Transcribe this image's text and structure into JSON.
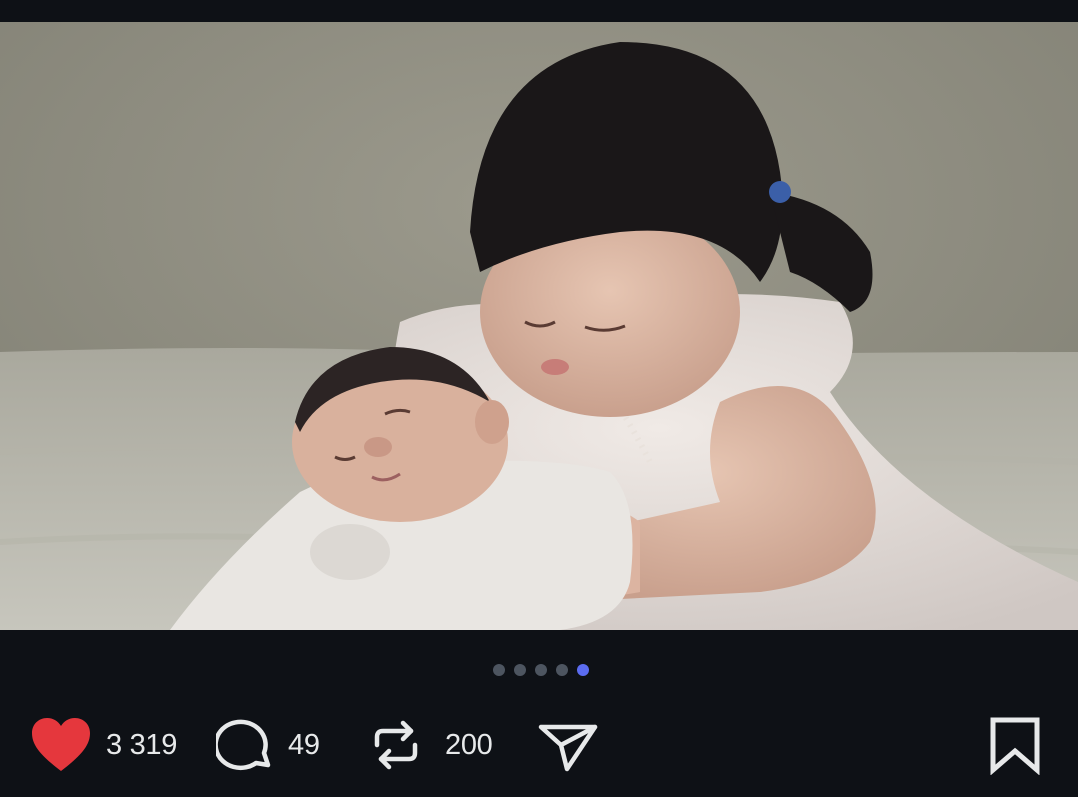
{
  "post": {
    "image": {
      "description_icon": "photo-of-child-holding-newborn"
    },
    "carousel": {
      "total": 5,
      "active_index": 4
    },
    "actions": {
      "like": {
        "icon": "heart-icon",
        "count": "3 319",
        "color": "#e5373d"
      },
      "reply": {
        "icon": "speech-bubble-icon",
        "count": "49"
      },
      "repost": {
        "icon": "repost-arrows-icon",
        "count": "200"
      },
      "share": {
        "icon": "paper-plane-icon"
      },
      "bookmark": {
        "icon": "bookmark-icon"
      }
    }
  },
  "colors": {
    "background": "#0e1116",
    "dot_inactive": "#4d5560",
    "dot_active": "#5b6cf0",
    "text": "#e7e9ea"
  }
}
